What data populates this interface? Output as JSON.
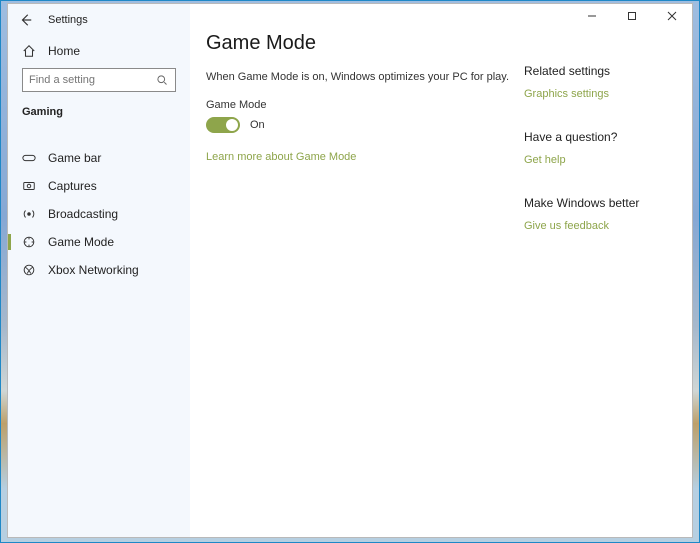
{
  "window": {
    "title": "Settings"
  },
  "header": {
    "home": "Home",
    "search_placeholder": "Find a setting",
    "category": "Gaming"
  },
  "nav": {
    "items": [
      {
        "label": "Game bar"
      },
      {
        "label": "Captures"
      },
      {
        "label": "Broadcasting"
      },
      {
        "label": "Game Mode"
      },
      {
        "label": "Xbox Networking"
      }
    ]
  },
  "page": {
    "title": "Game Mode",
    "description": "When Game Mode is on, Windows optimizes your PC for play.",
    "toggle_label": "Game Mode",
    "toggle_state": "On",
    "learn_more": "Learn more about Game Mode"
  },
  "aside": {
    "related_heading": "Related settings",
    "related_link": "Graphics settings",
    "question_heading": "Have a question?",
    "question_link": "Get help",
    "feedback_heading": "Make Windows better",
    "feedback_link": "Give us feedback"
  }
}
